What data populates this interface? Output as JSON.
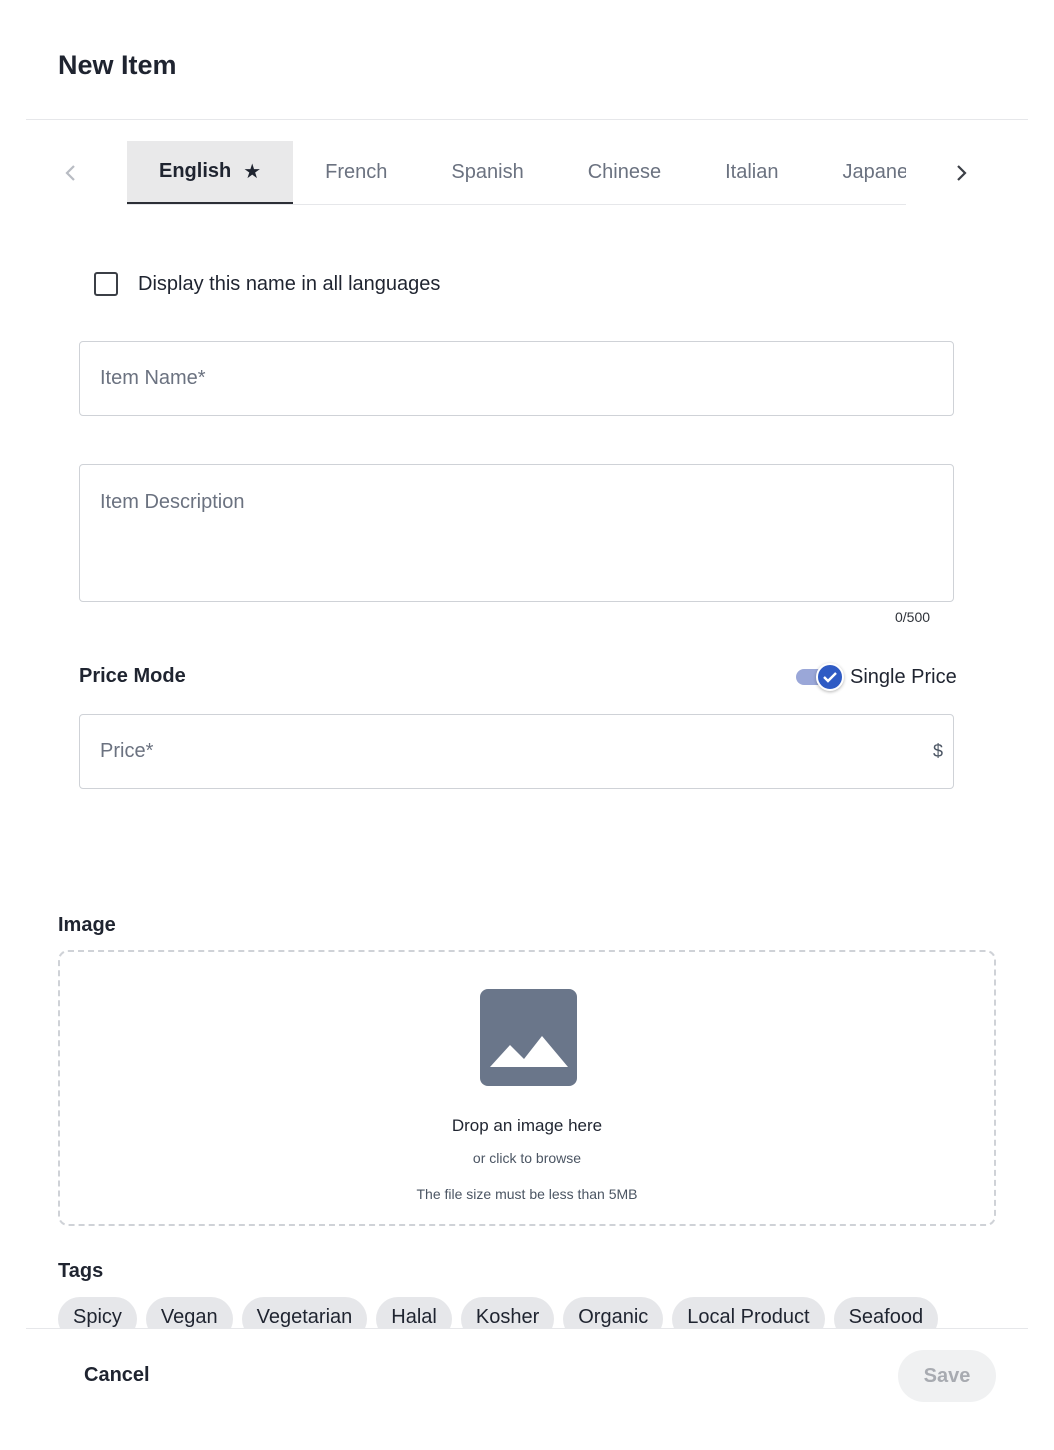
{
  "title": "New Item",
  "language_tabs": [
    {
      "label": "English",
      "active": true,
      "default": true
    },
    {
      "label": "French",
      "active": false
    },
    {
      "label": "Spanish",
      "active": false
    },
    {
      "label": "Chinese",
      "active": false
    },
    {
      "label": "Italian",
      "active": false
    },
    {
      "label": "Japanese",
      "active": false
    }
  ],
  "display_all_languages": {
    "label": "Display this name in all languages",
    "checked": false
  },
  "item_name": {
    "placeholder": "Item Name*",
    "value": ""
  },
  "item_description": {
    "placeholder": "Item Description",
    "value": "",
    "counter": "0/500"
  },
  "price_mode": {
    "label": "Price Mode",
    "toggle_label": "Single Price",
    "on": true
  },
  "price": {
    "placeholder": "Price*",
    "value": "",
    "currency": "$"
  },
  "image": {
    "label": "Image",
    "drop_title": "Drop an image here",
    "drop_sub": "or click to browse",
    "note": "The file size must be less than 5MB"
  },
  "tags": {
    "label": "Tags",
    "items": [
      "Spicy",
      "Vegan",
      "Vegetarian",
      "Halal",
      "Kosher",
      "Organic",
      "Local Product",
      "Seafood"
    ]
  },
  "footer": {
    "cancel_label": "Cancel",
    "save_label": "Save"
  },
  "colors": {
    "accent": "#2f5bc4",
    "toggle_track": "#9aa7d8",
    "image_icon": "#6a768a"
  },
  "icons": {
    "tab_prev": "chevron-left-icon",
    "tab_next": "chevron-right-icon",
    "default_language": "star-icon",
    "upload": "image-icon",
    "toggle_check": "check-icon"
  }
}
